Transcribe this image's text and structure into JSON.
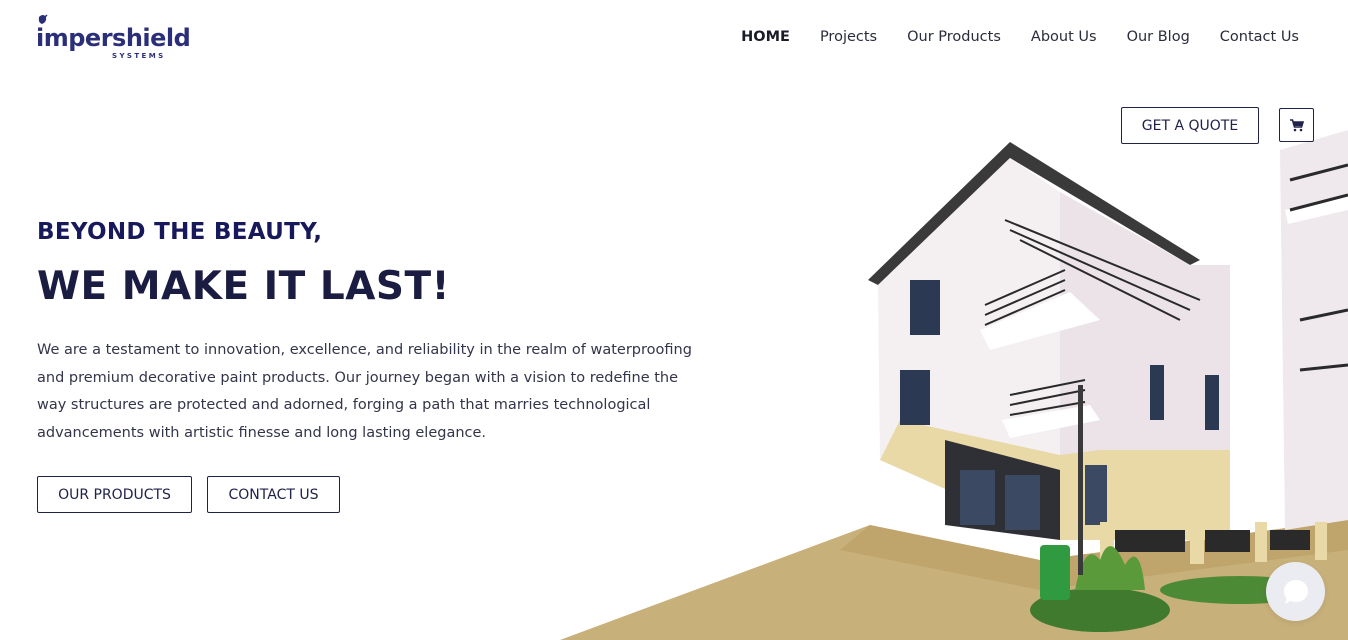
{
  "brand": {
    "name": "impershield",
    "tagline": "SYSTEMS",
    "color": "#2b2f7a"
  },
  "nav": {
    "items": [
      {
        "label": "HOME",
        "active": true
      },
      {
        "label": "Projects",
        "active": false
      },
      {
        "label": "Our Products",
        "active": false
      },
      {
        "label": "About Us",
        "active": false
      },
      {
        "label": "Our Blog",
        "active": false
      },
      {
        "label": "Contact Us",
        "active": false
      }
    ]
  },
  "header": {
    "quote_label": "GET A QUOTE",
    "cart_icon": "cart-icon"
  },
  "hero": {
    "kicker": "BEYOND THE BEAUTY,",
    "title": "WE MAKE IT LAST!",
    "body": "We are a testament to innovation, excellence, and reliability in the realm of waterproofing and premium decorative paint products. Our journey began with a vision to redefine the way structures are protected and adorned, forging a path that marries technological advancements with artistic finesse and long lasting elegance.",
    "products_label": "OUR PRODUCTS",
    "contact_label": "CONTACT US"
  },
  "chat": {
    "icon": "chat-icon"
  },
  "colors": {
    "navy": "#18195a",
    "text": "#33354a",
    "wall": "#eee6ea",
    "paving": "#c8b07a"
  }
}
